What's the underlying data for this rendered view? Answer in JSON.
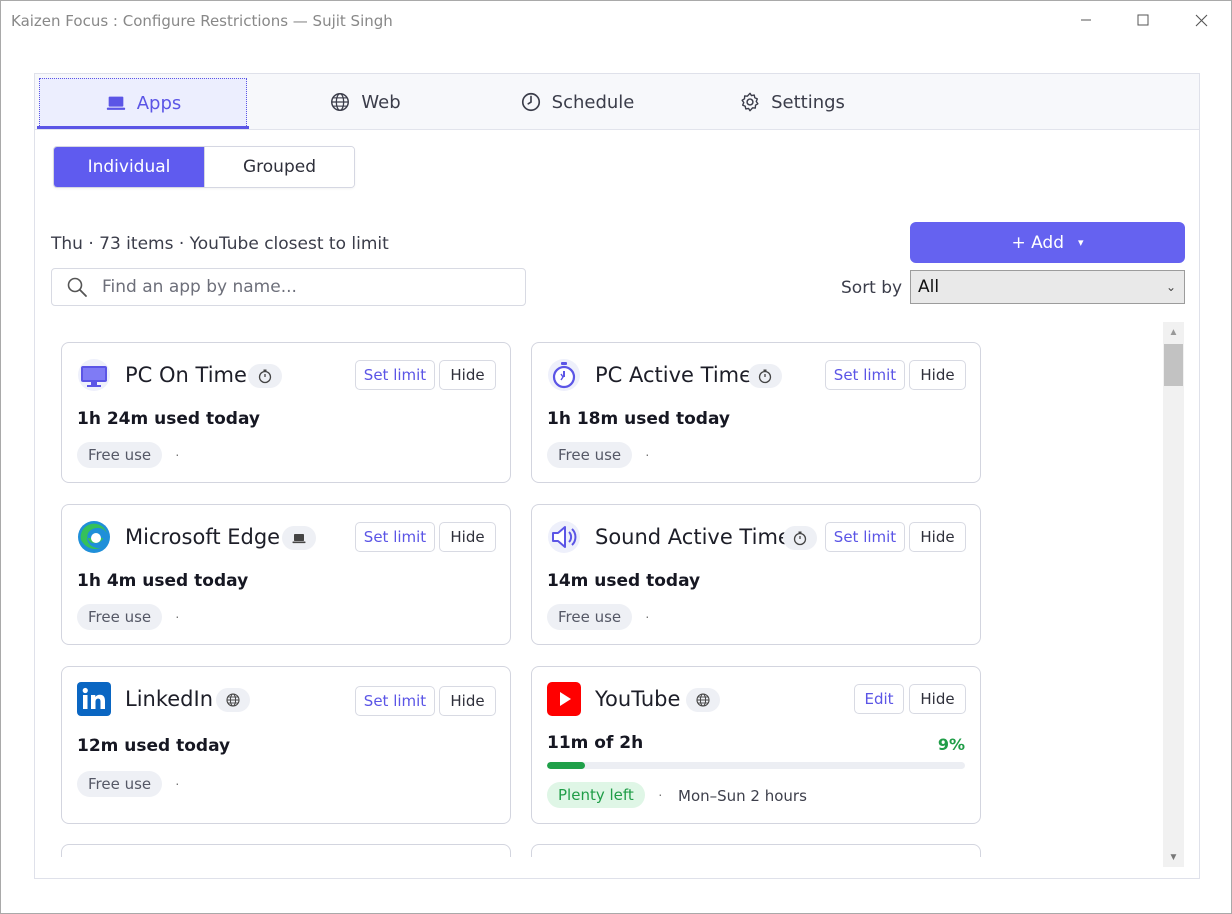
{
  "window": {
    "title": "Kaizen Focus : Configure Restrictions — Sujit Singh"
  },
  "tabs": [
    {
      "label": "Apps",
      "icon": "laptop-icon",
      "active": true
    },
    {
      "label": "Web",
      "icon": "globe-icon",
      "active": false
    },
    {
      "label": "Schedule",
      "icon": "clock-icon",
      "active": false
    },
    {
      "label": "Settings",
      "icon": "gear-icon",
      "active": false
    }
  ],
  "view_toggle": {
    "individual": "Individual",
    "grouped": "Grouped",
    "selected": "Individual"
  },
  "summary": "Thu · 73 items · YouTube closest to limit",
  "add_button": {
    "label": "+  Add",
    "caret": "▾"
  },
  "search": {
    "placeholder": "Find an app by name...",
    "value": ""
  },
  "sort": {
    "label": "Sort by",
    "value": "All"
  },
  "colors": {
    "accent": "#5f5bef",
    "success": "#1f9d47",
    "youtube": "#ff0000",
    "linkedin": "#0a66c2"
  },
  "cards": [
    {
      "name": "PC On Time",
      "icon": "monitor-icon",
      "type_icon": "stopwatch-icon",
      "usage": "1h 24m used today",
      "status": "Free use",
      "action": "Set limit",
      "hide": "Hide"
    },
    {
      "name": "PC Active Time",
      "icon": "stopwatch-icon",
      "type_icon": "stopwatch-icon",
      "usage": "1h 18m used today",
      "status": "Free use",
      "action": "Set limit",
      "hide": "Hide"
    },
    {
      "name": "Microsoft Edge",
      "icon": "edge-icon",
      "type_icon": "laptop-icon",
      "usage": "1h 4m used today",
      "status": "Free use",
      "action": "Set limit",
      "hide": "Hide"
    },
    {
      "name": "Sound Active Time",
      "icon": "speaker-icon",
      "type_icon": "stopwatch-icon",
      "usage": "14m used today",
      "status": "Free use",
      "action": "Set limit",
      "hide": "Hide"
    },
    {
      "name": "LinkedIn",
      "icon": "linkedin-icon",
      "type_icon": "globe-icon",
      "usage": "12m used today",
      "status": "Free use",
      "action": "Set limit",
      "hide": "Hide"
    },
    {
      "name": "YouTube",
      "icon": "youtube-icon",
      "type_icon": "globe-icon",
      "usage": "11m of 2h",
      "percent": "9%",
      "progress": 0.09,
      "status": "Plenty left",
      "schedule": "Mon–Sun 2 hours",
      "action": "Edit",
      "hide": "Hide"
    }
  ],
  "dot_separator": "·"
}
